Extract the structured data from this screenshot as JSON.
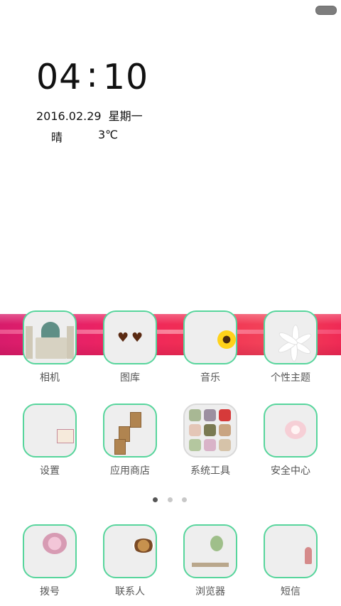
{
  "status": {
    "indicator": "status-pill-icon"
  },
  "clock": {
    "hours": "04",
    "separator": ":",
    "minutes": "10"
  },
  "date": {
    "date": "2016.02.29",
    "weekday": "星期一"
  },
  "weather": {
    "condition": "晴",
    "temperature": "3℃"
  },
  "dock_row1": [
    {
      "label": "相机",
      "icon": "camera-icon"
    },
    {
      "label": "图库",
      "icon": "gallery-icon"
    },
    {
      "label": "音乐",
      "icon": "music-icon"
    },
    {
      "label": "个性主题",
      "icon": "theme-icon"
    }
  ],
  "apps_row2": [
    {
      "label": "设置",
      "icon": "settings-icon"
    },
    {
      "label": "应用商店",
      "icon": "app-store-icon"
    },
    {
      "label": "系统工具",
      "icon": "system-tools-icon"
    },
    {
      "label": "安全中心",
      "icon": "security-center-icon"
    }
  ],
  "page_indicator": {
    "pages": 3,
    "current": 1
  },
  "dock_bottom": [
    {
      "label": "拨号",
      "icon": "phone-icon"
    },
    {
      "label": "联系人",
      "icon": "contacts-icon"
    },
    {
      "label": "浏览器",
      "icon": "browser-icon"
    },
    {
      "label": "短信",
      "icon": "sms-icon"
    }
  ],
  "colors": {
    "tile_border": "#57d59c",
    "ribbon": "#ef2a55",
    "label": "#555555"
  }
}
